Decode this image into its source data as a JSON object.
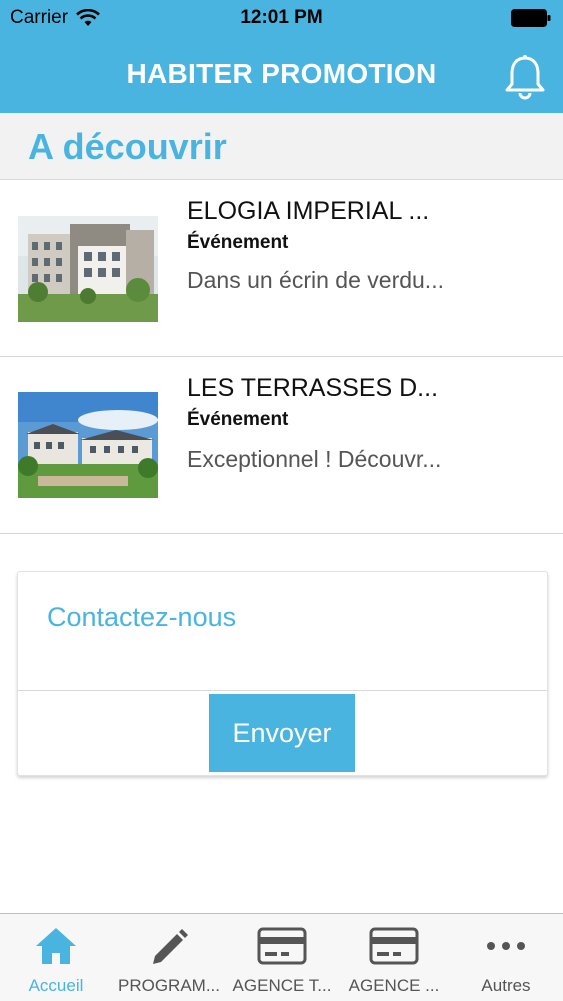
{
  "colors": {
    "accent": "#4ab4e0",
    "icon_gray": "#555555"
  },
  "status_bar": {
    "carrier": "Carrier",
    "time": "12:01 PM"
  },
  "navbar": {
    "title": "HABITER PROMOTION",
    "icon": "bell-icon"
  },
  "section": {
    "title": "A découvrir"
  },
  "items": [
    {
      "title": "ELOGIA IMPERIAL ...",
      "category": "Événement",
      "description": "Dans un écrin de verdu..."
    },
    {
      "title": "LES TERRASSES D...",
      "category": "Événement",
      "description": "Exceptionnel ! Découvr..."
    }
  ],
  "contact": {
    "label": "Contactez-nous",
    "button": "Envoyer"
  },
  "tabs": [
    {
      "label": "Accueil",
      "icon": "home-icon",
      "active": true
    },
    {
      "label": "PROGRAM...",
      "icon": "pencil-icon",
      "active": false
    },
    {
      "label": "AGENCE T...",
      "icon": "card-icon",
      "active": false
    },
    {
      "label": "AGENCE ...",
      "icon": "card-icon",
      "active": false
    },
    {
      "label": "Autres",
      "icon": "more-icon",
      "active": false
    }
  ]
}
